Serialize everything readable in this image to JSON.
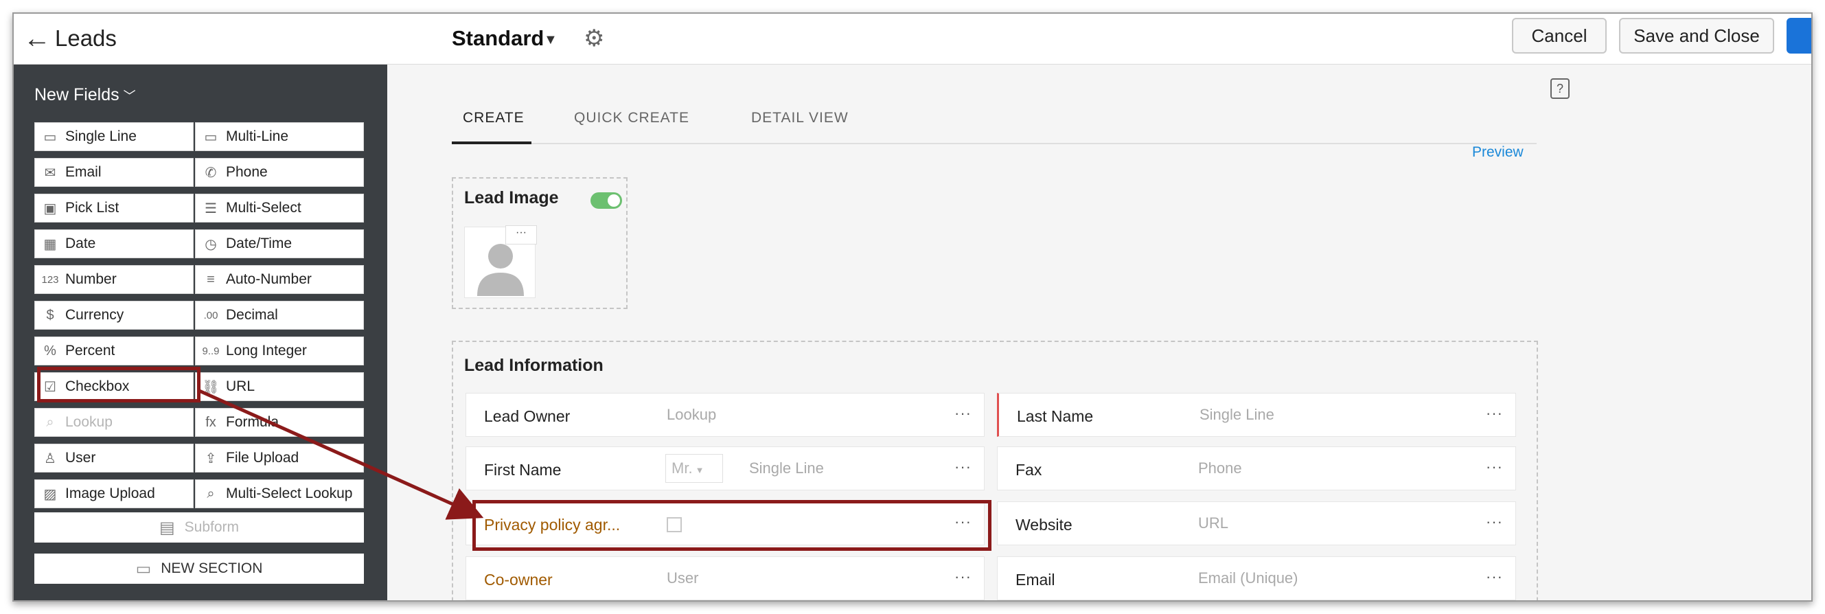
{
  "header": {
    "back_icon": "arrow-left-icon",
    "module": "Leads",
    "layout": "Standard",
    "settings_icon": "gear-icon",
    "cancel": "Cancel",
    "save_and_close": "Save and Close"
  },
  "sidebar": {
    "title": "New Fields",
    "fields": [
      {
        "label": "Single Line",
        "icon": "single-line-icon",
        "glyph": "▭"
      },
      {
        "label": "Multi-Line",
        "icon": "multi-line-icon",
        "glyph": "▭"
      },
      {
        "label": "Email",
        "icon": "email-icon",
        "glyph": "✉"
      },
      {
        "label": "Phone",
        "icon": "phone-icon",
        "glyph": "✆"
      },
      {
        "label": "Pick List",
        "icon": "pick-list-icon",
        "glyph": "▣"
      },
      {
        "label": "Multi-Select",
        "icon": "multi-select-icon",
        "glyph": "☰"
      },
      {
        "label": "Date",
        "icon": "date-icon",
        "glyph": "▦"
      },
      {
        "label": "Date/Time",
        "icon": "date-time-icon",
        "glyph": "◷"
      },
      {
        "label": "Number",
        "icon": "number-icon",
        "glyph": "123"
      },
      {
        "label": "Auto-Number",
        "icon": "auto-number-icon",
        "glyph": "≡"
      },
      {
        "label": "Currency",
        "icon": "currency-icon",
        "glyph": "$"
      },
      {
        "label": "Decimal",
        "icon": "decimal-icon",
        "glyph": ".00"
      },
      {
        "label": "Percent",
        "icon": "percent-icon",
        "glyph": "%"
      },
      {
        "label": "Long Integer",
        "icon": "long-integer-icon",
        "glyph": "9..9"
      },
      {
        "label": "Checkbox",
        "icon": "checkbox-icon",
        "glyph": "☑"
      },
      {
        "label": "URL",
        "icon": "url-link-icon",
        "glyph": "⛓"
      },
      {
        "label": "Lookup",
        "icon": "lookup-icon",
        "glyph": "⌕"
      },
      {
        "label": "Formula",
        "icon": "formula-icon",
        "glyph": "fx"
      },
      {
        "label": "User",
        "icon": "user-icon",
        "glyph": "♙"
      },
      {
        "label": "File Upload",
        "icon": "file-upload-icon",
        "glyph": "⇪"
      },
      {
        "label": "Image Upload",
        "icon": "image-upload-icon",
        "glyph": "▨"
      },
      {
        "label": "Multi-Select Lookup",
        "icon": "multi-select-lookup-icon",
        "glyph": "⌕"
      }
    ],
    "subform": "Subform",
    "new_section": "NEW SECTION"
  },
  "main": {
    "tabs": [
      "CREATE",
      "QUICK CREATE",
      "DETAIL VIEW"
    ],
    "preview": "Preview",
    "lead_image": {
      "title": "Lead Image",
      "dots": "···"
    },
    "section_title": "Lead Information",
    "dots": "···",
    "salutation": "Mr.",
    "left_fields": [
      {
        "label": "Lead Owner",
        "placeholder": "Lookup"
      },
      {
        "label": "First Name",
        "placeholder": "Single Line"
      },
      {
        "label": "Privacy policy agr...",
        "placeholder": ""
      },
      {
        "label": "Co-owner",
        "placeholder": "User"
      }
    ],
    "right_fields": [
      {
        "label": "Last Name",
        "placeholder": "Single Line"
      },
      {
        "label": "Fax",
        "placeholder": "Phone"
      },
      {
        "label": "Website",
        "placeholder": "URL"
      },
      {
        "label": "Email",
        "placeholder": "Email (Unique)"
      }
    ]
  },
  "colors": {
    "highlight": "#8b1a1a",
    "toggle_on": "#6cc070",
    "accent": "#1a73d9",
    "custom_label": "#a05a00"
  }
}
